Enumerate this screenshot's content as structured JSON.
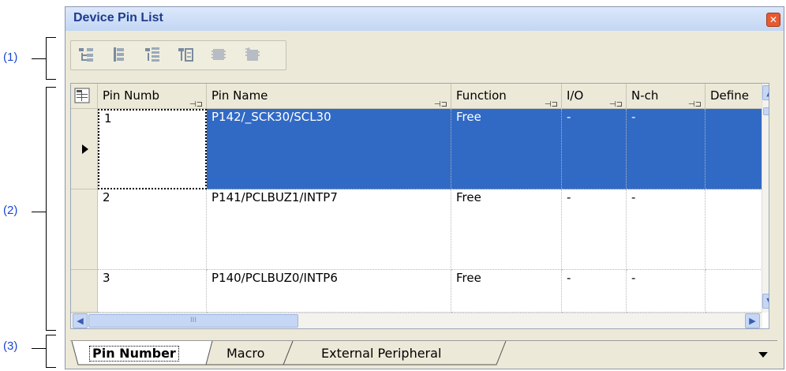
{
  "callouts": [
    "(1)",
    "(2)",
    "(3)"
  ],
  "window": {
    "title": "Device Pin List",
    "close_icon": "close-icon"
  },
  "toolbar": {
    "buttons": [
      {
        "icon": "tree-expand-icon",
        "enabled": true
      },
      {
        "icon": "tree-collapse-icon",
        "enabled": true
      },
      {
        "icon": "tree-sort-icon",
        "enabled": true
      },
      {
        "icon": "tree-view-icon",
        "enabled": true
      },
      {
        "icon": "module-set-icon",
        "enabled": false
      },
      {
        "icon": "module-clear-icon",
        "enabled": false
      }
    ]
  },
  "grid": {
    "corner_icon": "grid-settings-icon",
    "columns": [
      "Pin Numb",
      "Pin Name",
      "Function",
      "I/O",
      "N-ch",
      "Define"
    ],
    "rows": [
      {
        "pin_number": "1",
        "pin_name": "P142/_SCK30/SCL30",
        "function": "Free",
        "io": "-",
        "nch": "-",
        "define": "",
        "selected": true
      },
      {
        "pin_number": "2",
        "pin_name": "P141/PCLBUZ1/INTP7",
        "function": "Free",
        "io": "-",
        "nch": "-",
        "define": "",
        "selected": false
      },
      {
        "pin_number": "3",
        "pin_name": "P140/PCLBUZ0/INTP6",
        "function": "Free",
        "io": "-",
        "nch": "-",
        "define": "",
        "selected": false
      }
    ],
    "hscroll_grip": "III"
  },
  "tabs": {
    "items": [
      {
        "label": "Pin Number",
        "active": true
      },
      {
        "label": "Macro",
        "active": false
      },
      {
        "label": "External Peripheral",
        "active": false
      }
    ],
    "overflow_icon": "dropdown-arrow-icon"
  },
  "colors": {
    "selection": "#316ac5",
    "callout": "#1a46d6",
    "title": "#1f3c8c"
  }
}
